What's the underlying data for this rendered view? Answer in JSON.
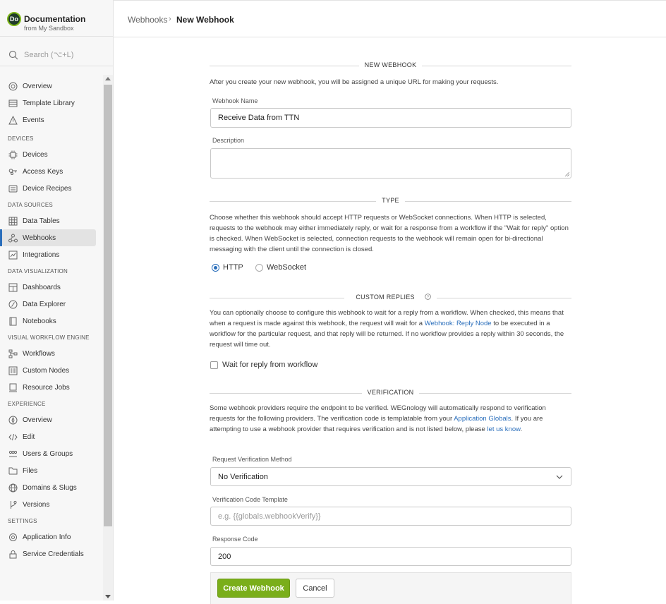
{
  "app": {
    "logo_text": "Do",
    "title": "Documentation",
    "subtitle": "from My Sandbox"
  },
  "search": {
    "placeholder": "Search (⌥+L)"
  },
  "nav": {
    "top_items": [
      {
        "label": "Overview",
        "icon": "gauge-icon"
      },
      {
        "label": "Template Library",
        "icon": "library-icon"
      },
      {
        "label": "Events",
        "icon": "warning-icon"
      }
    ],
    "sections": [
      {
        "title": "DEVICES",
        "items": [
          {
            "label": "Devices",
            "icon": "chip-icon"
          },
          {
            "label": "Access Keys",
            "icon": "keys-icon"
          },
          {
            "label": "Device Recipes",
            "icon": "recipe-icon"
          }
        ]
      },
      {
        "title": "DATA SOURCES",
        "items": [
          {
            "label": "Data Tables",
            "icon": "table-icon"
          },
          {
            "label": "Webhooks",
            "icon": "webhook-icon",
            "active": true
          },
          {
            "label": "Integrations",
            "icon": "integration-icon"
          }
        ]
      },
      {
        "title": "DATA VISUALIZATION",
        "items": [
          {
            "label": "Dashboards",
            "icon": "dashboard-icon"
          },
          {
            "label": "Data Explorer",
            "icon": "explorer-icon"
          },
          {
            "label": "Notebooks",
            "icon": "notebook-icon"
          }
        ]
      },
      {
        "title": "VISUAL WORKFLOW ENGINE",
        "items": [
          {
            "label": "Workflows",
            "icon": "workflow-icon"
          },
          {
            "label": "Custom Nodes",
            "icon": "custom-nodes-icon"
          },
          {
            "label": "Resource Jobs",
            "icon": "jobs-icon"
          }
        ]
      },
      {
        "title": "EXPERIENCE",
        "items": [
          {
            "label": "Overview",
            "icon": "compass-icon"
          },
          {
            "label": "Edit",
            "icon": "code-icon"
          },
          {
            "label": "Users & Groups",
            "icon": "users-icon"
          },
          {
            "label": "Files",
            "icon": "folder-icon"
          },
          {
            "label": "Domains & Slugs",
            "icon": "globe-icon"
          },
          {
            "label": "Versions",
            "icon": "branch-icon"
          }
        ]
      },
      {
        "title": "SETTINGS",
        "items": [
          {
            "label": "Application Info",
            "icon": "gear-icon"
          },
          {
            "label": "Service Credentials",
            "icon": "lock-icon"
          }
        ]
      }
    ]
  },
  "breadcrumb": {
    "parent": "Webhooks",
    "separator": "›",
    "current": "New Webhook"
  },
  "form": {
    "new_webhook": {
      "heading": "NEW WEBHOOK",
      "intro": "After you create your new webhook, you will be assigned a unique URL for making your requests.",
      "name_label": "Webhook Name",
      "name_value": "Receive Data from TTN",
      "description_label": "Description",
      "description_value": ""
    },
    "type": {
      "heading": "TYPE",
      "text": "Choose whether this webhook should accept HTTP requests or WebSocket connections. When HTTP is selected, requests to the webhook may either immediately reply, or wait for a response from a workflow if the \"Wait for reply\" option is checked. When WebSocket is selected, connection requests to the webhook will remain open for bi-directional messaging with the client until the connection is closed.",
      "options": [
        "HTTP",
        "WebSocket"
      ],
      "selected": "HTTP"
    },
    "custom_replies": {
      "heading": "CUSTOM REPLIES",
      "help_icon": "question-circle-icon",
      "text_before": "You can optionally choose to configure this webhook to wait for a reply from a workflow. When checked, this means that when a request is made against this webhook, the request will wait for a ",
      "link": "Webhook: Reply Node",
      "text_after": " to be executed in a workflow for the particular request, and that reply will be returned. If no workflow provides a reply within 30 seconds, the request will time out.",
      "checkbox_label": "Wait for reply from workflow",
      "checked": false
    },
    "verification": {
      "heading": "VERIFICATION",
      "text_1": "Some webhook providers require the endpoint to be verified. WEGnology will automatically respond to verification requests for the following providers. The verification code is templatable from your ",
      "link_1": "Application Globals",
      "text_2": ". If you are attempting to use a webhook provider that requires verification and is not listed below, please ",
      "link_2": "let us know",
      "text_3": ".",
      "method_label": "Request Verification Method",
      "method_value": "No Verification",
      "template_label": "Verification Code Template",
      "template_placeholder": "e.g. {{globals.webhookVerify}}",
      "response_label": "Response Code",
      "response_value": "200"
    },
    "actions": {
      "create": "Create Webhook",
      "cancel": "Cancel"
    }
  },
  "colors": {
    "accent": "#2a6ebb",
    "primary_button": "#7aae1a",
    "sidebar_bg": "#f7f7f7"
  }
}
